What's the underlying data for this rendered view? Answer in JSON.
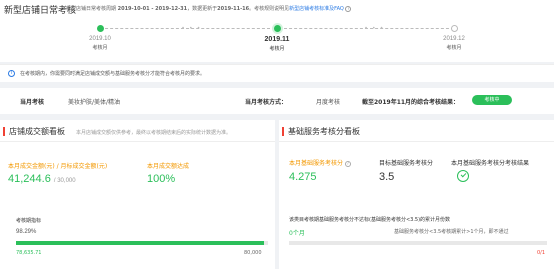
{
  "header": {
    "title": "新型店铺日常考核",
    "subtitle_prefix": "新型店铺日常考核周期",
    "period": "2019-10-01 - 2019-12-31",
    "update_note": "，数据更新于",
    "update_date": "2019-11-16",
    "subtitle_suffix": "。考核规则说明见",
    "link": "新型店铺考核标准及FAQ"
  },
  "timeline": [
    {
      "date": "2019.10",
      "label": "考核月",
      "state": "done"
    },
    {
      "date": "2019.11",
      "label": "考核月",
      "state": "current"
    },
    {
      "date": "2019.12",
      "label": "考核月",
      "state": "upcoming"
    }
  ],
  "notice": "在考核期内，你需要同时满足店铺成交额与基础服务考核分才能符合考核月的要求。",
  "info": {
    "month_category_label": "当月考核",
    "month_category_value": "美妆护肤/美体/精油",
    "method_label": "当月考核方式：",
    "method_value": "月度考核",
    "result_label": "截至2019年11月的综合考核结果：",
    "result_badge": "考核中"
  },
  "sales_card": {
    "title": "店铺成交额看板",
    "hint": "本月店铺成交额仅供参考，最终以考核期结束后的实际统计数据为准。",
    "kpi1_label": "本月成交金额(元) / 月标成交金额(元)",
    "kpi1_value": "41,244.6",
    "kpi1_target": "/ 30,000",
    "kpi2_label": "本月成交额达成",
    "kpi2_value": "100%",
    "progress_label": "考核期指标",
    "progress_pct": "98.29%",
    "progress_fraction": 0.9829,
    "progress_current": "78,635.71",
    "progress_target": "80,000"
  },
  "service_card": {
    "title": "基础服务考核分看板",
    "kpi1_label": "本月基础服务考核分",
    "kpi1_value": "4.275",
    "kpi2_label": "目标基础服务考核分",
    "kpi2_value": "3.5",
    "kpi3_label": "本月基础服务考核分考核结果",
    "months_label": "该类目考核期基础服务考核分不达标(基础服务考核分<3.5)的累计月份数",
    "months_value": "0个月",
    "note": "基础服务考核分<3.5考核期累计>1个月，即不通过",
    "ratio": "0/1"
  },
  "colors": {
    "accent_green": "#2bbf5a",
    "accent_orange": "#f39800",
    "accent_red": "#f04134",
    "link_blue": "#2b7be4"
  }
}
